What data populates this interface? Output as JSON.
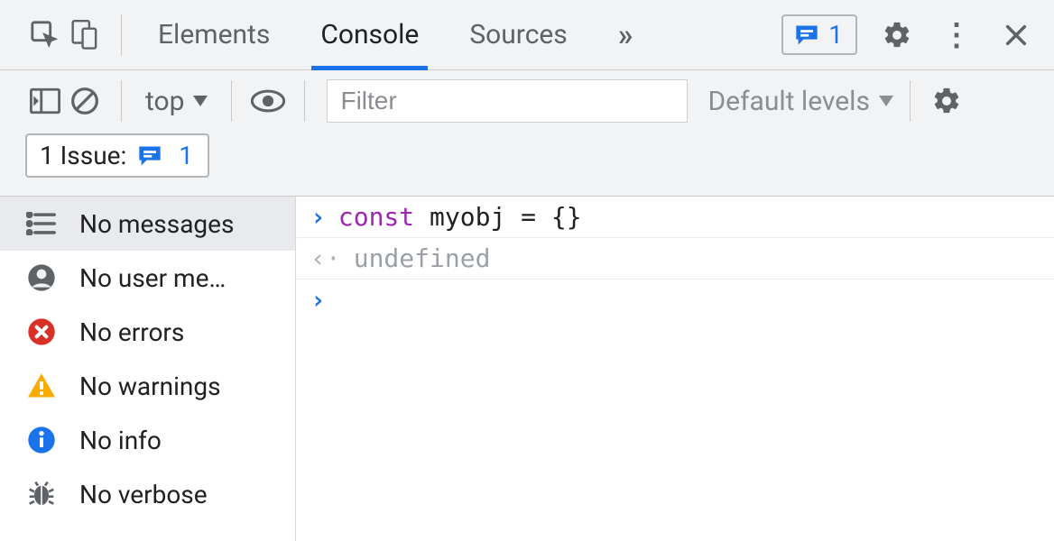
{
  "tabbar": {
    "tabs": [
      "Elements",
      "Console",
      "Sources"
    ],
    "active_index": 1,
    "issues_pill_count": "1"
  },
  "toolbar": {
    "context_label": "top",
    "filter_placeholder": "Filter",
    "levels_label": "Default levels",
    "issues_label": "1 Issue:",
    "issues_count": "1"
  },
  "sidebar": {
    "items": [
      {
        "label": "No messages",
        "kind": "all"
      },
      {
        "label": "No user me…",
        "kind": "user"
      },
      {
        "label": "No errors",
        "kind": "error"
      },
      {
        "label": "No warnings",
        "kind": "warning"
      },
      {
        "label": "No info",
        "kind": "info"
      },
      {
        "label": "No verbose",
        "kind": "verbose"
      }
    ],
    "selected_index": 0
  },
  "console": {
    "input_keyword": "const",
    "input_rest": " myobj = {}",
    "output": "undefined"
  }
}
